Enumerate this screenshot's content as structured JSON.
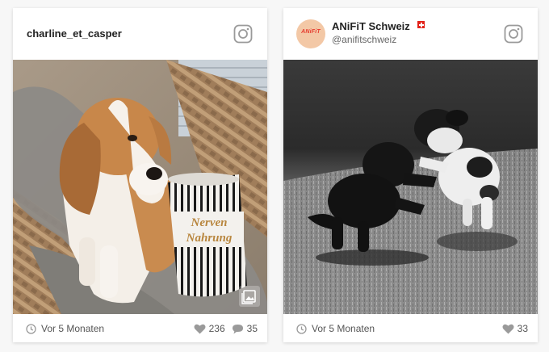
{
  "posts": [
    {
      "username": "charline_et_casper",
      "photo_alt": "Beagle",
      "mug_text_line1": "Nerven",
      "mug_text_line2": "Nahrung",
      "time": "Vor 5 Monaten",
      "likes": "236",
      "comments": "35",
      "icons": {
        "platform": "instagram-icon",
        "time": "clock-icon",
        "likes": "heart-icon",
        "comments": "comment-icon",
        "badge": "gallery-icon"
      }
    },
    {
      "account_name": "ANiFiT Schweiz",
      "handle": "@anifitschweiz",
      "avatar_logo": "ANiFiT",
      "time": "Vor 5 Monaten",
      "likes": "33",
      "icons": {
        "platform": "instagram-icon",
        "time": "clock-icon",
        "likes": "heart-icon",
        "flag": "swiss-flag-icon"
      }
    }
  ],
  "colors": {
    "card": "#ffffff",
    "background": "#f7f7f7",
    "icon_gray": "#9a9a9a",
    "flag_red": "#e2231a"
  }
}
